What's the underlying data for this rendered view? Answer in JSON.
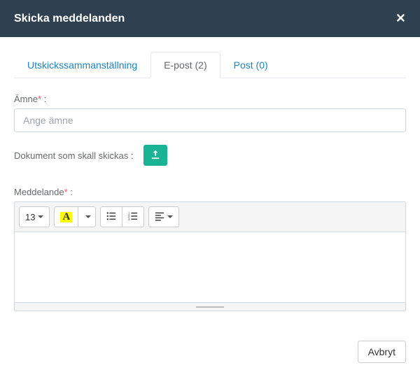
{
  "header": {
    "title": "Skicka meddelanden"
  },
  "tabs": [
    {
      "label": "Utskickssammanställning"
    },
    {
      "label": "E-post (2)"
    },
    {
      "label": "Post (0)"
    }
  ],
  "form": {
    "subject_label": "Ämne",
    "subject_placeholder": "Ange ämne",
    "documents_label": "Dokument som skall skickas :",
    "message_label": "Meddelande"
  },
  "toolbar": {
    "font_size": "13"
  },
  "footer": {
    "cancel_label": "Avbryt"
  }
}
